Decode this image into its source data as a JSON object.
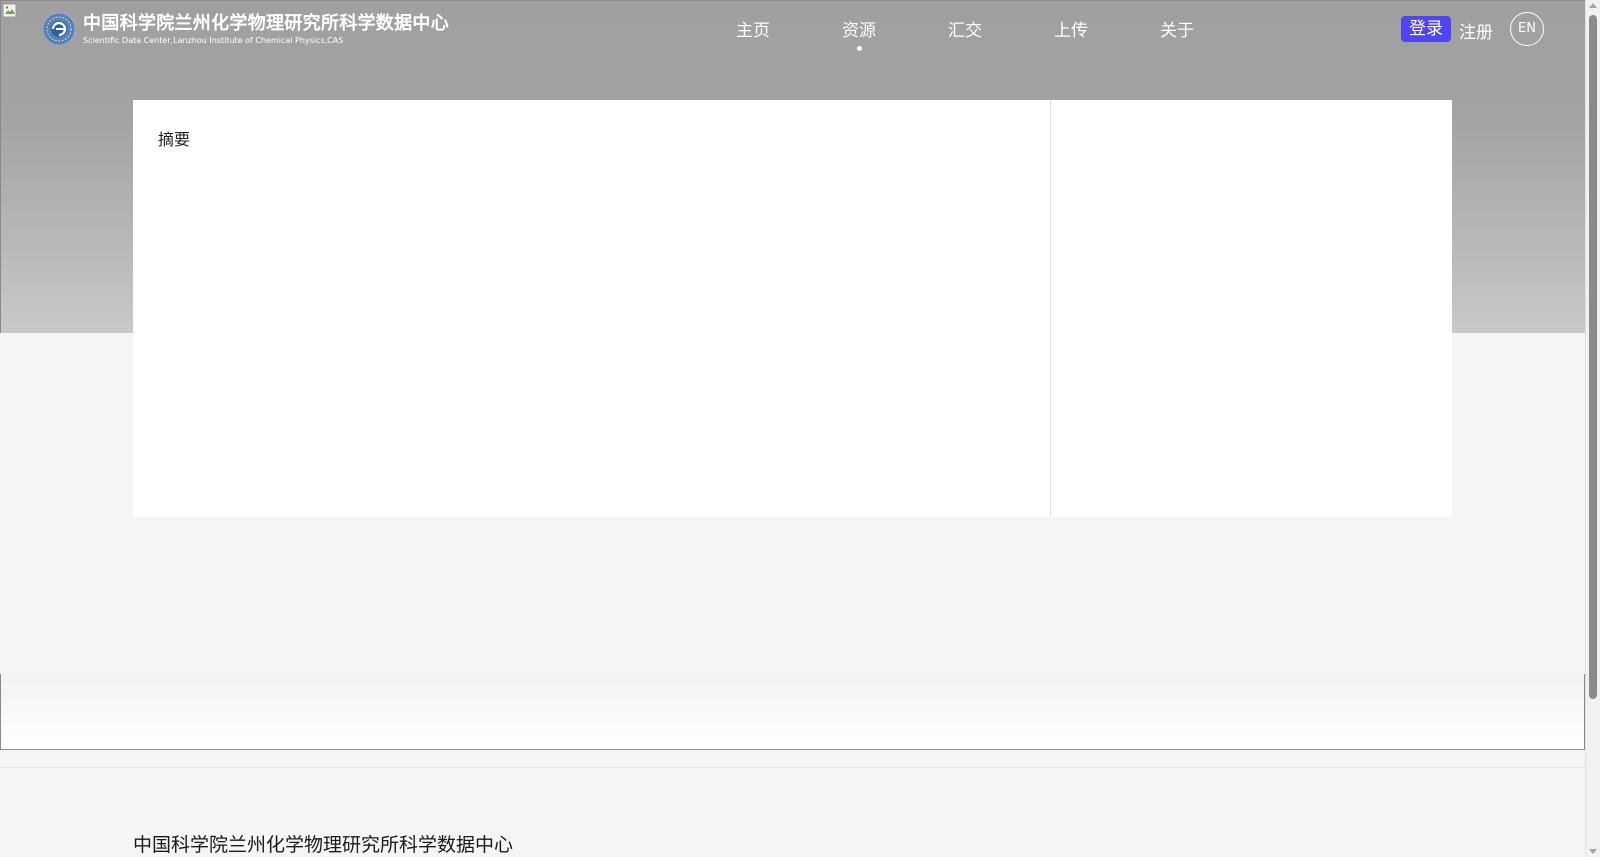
{
  "header": {
    "title": "中国科学院兰州化学物理研究所科学数据中心",
    "subtitle": "Scientific Data Center,Lanzhou Institute of Chemical Physics,CAS",
    "nav": [
      {
        "label": "主页",
        "active": false
      },
      {
        "label": "资源",
        "active": true
      },
      {
        "label": "汇交",
        "active": false
      },
      {
        "label": "上传",
        "active": false
      },
      {
        "label": "关于",
        "active": false
      }
    ],
    "login_label": "登录",
    "register_label": "注册",
    "lang_label": "EN"
  },
  "colors": {
    "login_button": "#5046f0",
    "banner": "#a3a3a3",
    "page_background": "#f5f5f5"
  },
  "main": {
    "abstract_title": "摘要"
  },
  "footer": {
    "title": "中国科学院兰州化学物理研究所科学数据中心"
  },
  "icons": {
    "logo": "institute-logo-icon",
    "broken_image": "broken-image-icon"
  }
}
